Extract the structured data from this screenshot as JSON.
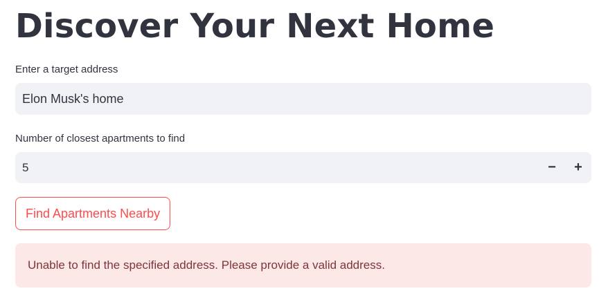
{
  "header": {
    "title": "Discover Your Next Home"
  },
  "address_field": {
    "label": "Enter a target address",
    "value": "Elon Musk's home"
  },
  "count_field": {
    "label": "Number of closest apartments to find",
    "value": "5",
    "decrement_symbol": "−",
    "increment_symbol": "+"
  },
  "actions": {
    "find_label": "Find Apartments Nearby"
  },
  "alert": {
    "message": "Unable to find the specified address. Please provide a valid address.",
    "type": "error"
  },
  "colors": {
    "primary": "#ff4b4b",
    "text": "#31333f",
    "input_bg": "#f0f2f6",
    "error_bg": "#fde8e8",
    "error_text": "#7d353b"
  }
}
